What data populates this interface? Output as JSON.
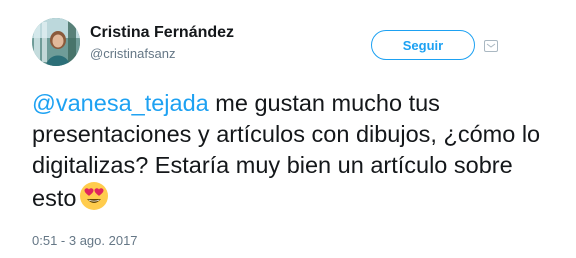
{
  "user": {
    "name": "Cristina Fernández",
    "handle": "@cristinafsanz"
  },
  "follow_button": {
    "label": "Seguir"
  },
  "tweet": {
    "mention": "@vanesa_tejada",
    "body": " me gustan mucho tus presentaciones y artículos con dibujos, ¿cómo lo digitalizas? Estaría muy bien un artículo sobre esto",
    "emoji": "heart-eyes-emoji",
    "timestamp": "0:51 - 3 ago. 2017"
  },
  "colors": {
    "accent": "#1da1f2",
    "secondary_text": "#657786",
    "primary_text": "#14171a"
  },
  "icons": {
    "brand": "twitter-bird-icon"
  }
}
